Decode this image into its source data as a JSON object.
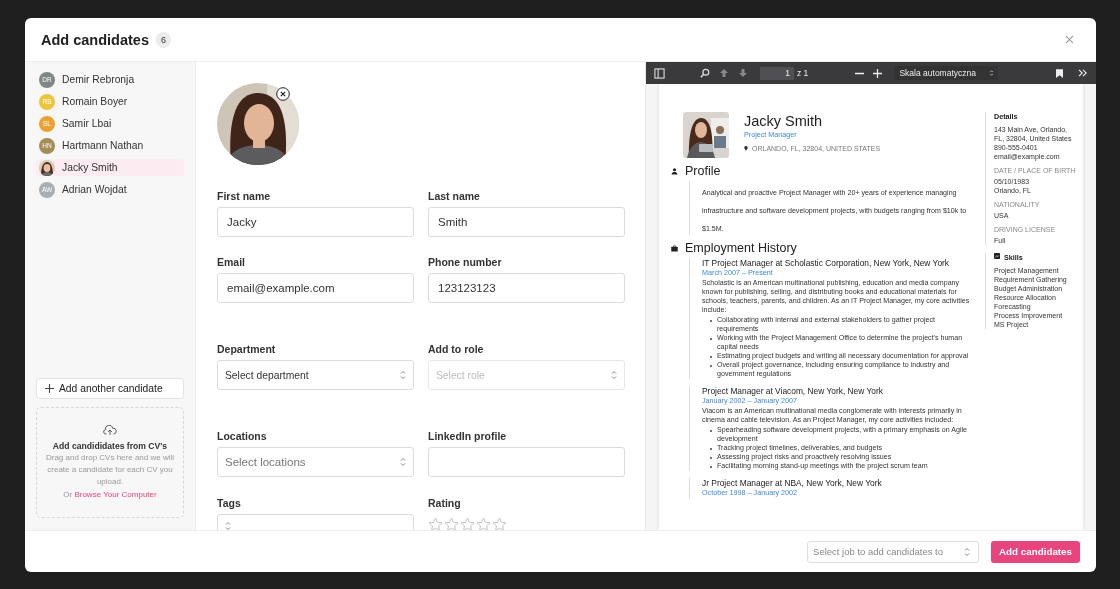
{
  "modal": {
    "title": "Add candidates",
    "count": "6"
  },
  "candidates": [
    {
      "name": "Demir Rebronja",
      "initials": "DR",
      "kind": "initials",
      "color": "#7e8782",
      "selected": false
    },
    {
      "name": "Romain Boyer",
      "initials": "RB",
      "kind": "initials",
      "color": "#eec43b",
      "selected": false
    },
    {
      "name": "Samir Lbai",
      "initials": "SL",
      "kind": "initials",
      "color": "#eba133",
      "selected": false
    },
    {
      "name": "Hartmann Nathan",
      "initials": "HN",
      "kind": "initials",
      "color": "#a68c55",
      "selected": false
    },
    {
      "name": "Jacky Smith",
      "selected": true
    },
    {
      "name": "Adrian Wojdat",
      "initials": "AW",
      "kind": "initials",
      "color": "#a9aeb2",
      "selected": false
    }
  ],
  "add_another": "Add another candidate",
  "upload": {
    "title": "Add candididates from CV's",
    "text": "Drag and drop CVs here and we will create a candidate for each CV you upload.",
    "prefix": "Or",
    "link": "Browse Your Computer"
  },
  "fields": [
    {
      "label": "First name",
      "kind": "input",
      "value": "Jacky"
    },
    {
      "label": "Last name",
      "kind": "input",
      "value": "Smith"
    },
    {
      "label": "Email",
      "kind": "input",
      "value": "email@example.com"
    },
    {
      "label": "Phone number",
      "kind": "input",
      "value": "123123123"
    },
    {
      "label": "Department",
      "kind": "select",
      "value": "Select department",
      "disabled": false
    },
    {
      "label": "Add to role",
      "kind": "select",
      "placeholder": "Select role",
      "disabled": true
    },
    {
      "label": "Locations",
      "kind": "select",
      "placeholder": "Select locations",
      "disabled": false
    },
    {
      "label": "LinkedIn profile",
      "kind": "input"
    },
    {
      "label": "Tags",
      "kind": "select",
      "disabled": false
    },
    {
      "label": "Rating",
      "kind": "rating",
      "stars": 0
    }
  ],
  "viewer": {
    "page": "1",
    "of": "z 1",
    "zoom": "Skala automatyczna"
  },
  "cv": {
    "name": "Jacky Smith",
    "title": "Project Manager",
    "location": "ORLANDO, FL, 32804, UNITED STATES",
    "profile": {
      "heading": "Profile",
      "text": "Analytical and proactive Project Manager with 20+ years of experience managing infrastructure and software development projects, with budgets ranging from $10k to $1.5M."
    },
    "history": {
      "heading": "Employment History",
      "jobs": [
        {
          "title": "IT Project Manager at Scholastic Corporation, New York, New York",
          "dates": "March 2007  –  Present",
          "text": "Scholastic is an American multinational publishing, education and media company known for publishing, selling, and distributing books and educational materials for schools, teachers, parents, and children. As an IT Project Manager, my core activities include:",
          "bullets": [
            "Collaborating with internal and external stakeholders to gather project requirements",
            "Working with the Project Management Office to determine the project's human capital needs",
            "Estimating project budgets and writing all necessary documentation for approval",
            "Overall project governance, including ensuring compliance to industry and government regulations"
          ]
        },
        {
          "title": "Project Manager at Viacom, New York, New York",
          "dates": "January 2002  –  January 2007",
          "text": "Viacom is an American multinational media conglomerate with interests primarily in cinema and cable television. As an Project Manager, my core activities included:",
          "bullets": [
            "Spearheading software development projects, with a primary emphasis on Agile development",
            "Tracking project timelines, deliverables, and budgets",
            "Assessing project risks and proactively resolving issues",
            "Facilitating morning stand-up meetings with the project scrum team"
          ]
        },
        {
          "title": "Jr Project Manager at NBA, New York, New York",
          "dates": "October 1998  –  January 2002"
        }
      ]
    },
    "details": {
      "heading": "Details",
      "address": "143 Main Ave, Orlando, FL, 32804, United States",
      "phone": "890-555-0401",
      "email": "email@example.com"
    },
    "facts": [
      {
        "label": "DATE / PLACE OF BIRTH",
        "lines": [
          "05/10/1983",
          "Orlando, FL"
        ]
      },
      {
        "label": "NATIONALITY",
        "lines": [
          "USA"
        ]
      },
      {
        "label": "DRIVING LICENSE",
        "lines": [
          "Full"
        ]
      }
    ],
    "skills": {
      "heading": "Skills",
      "items": [
        "Project Management",
        "Requirement Gathering",
        "Budget Administration",
        "Resource Allocation",
        "Forecasting",
        "Process Improvement",
        "MS Project"
      ]
    }
  },
  "footer": {
    "job_placeholder": "Select job to add candidates to",
    "submit": "Add candidates"
  }
}
